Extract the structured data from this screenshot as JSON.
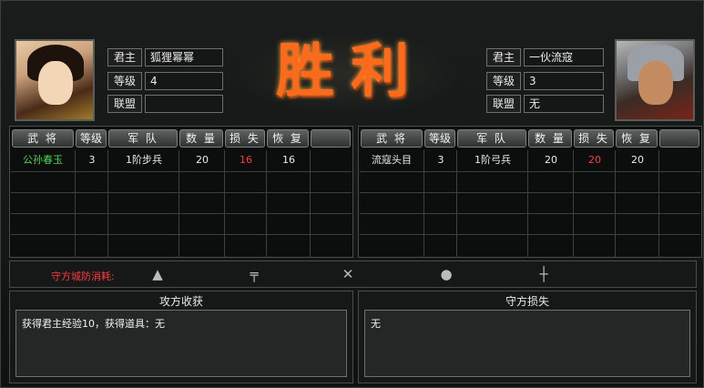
{
  "attacker": {
    "lord_label": "君主",
    "lord_name": "狐狸幂幂",
    "level_label": "等级",
    "level": "4",
    "alliance_label": "联盟",
    "alliance": ""
  },
  "defender": {
    "lord_label": "君主",
    "lord_name": "一伙流寇",
    "level_label": "等级",
    "level": "3",
    "alliance_label": "联盟",
    "alliance": "无"
  },
  "result_title": [
    "胜",
    "利"
  ],
  "table_headers": [
    "武 将",
    "等级",
    "军 队",
    "数 量",
    "损 失",
    "恢 复"
  ],
  "attacker_rows": [
    {
      "general": "公孙春玉",
      "level": "3",
      "army": "1阶步兵",
      "count": "20",
      "loss": "16",
      "recover": "16"
    }
  ],
  "defender_rows": [
    {
      "general": "流寇头目",
      "level": "3",
      "army": "1阶弓兵",
      "count": "20",
      "loss": "20",
      "recover": "20"
    }
  ],
  "defense": {
    "label": "守方城防消耗:",
    "icons": [
      "spikes-icon",
      "crossbow-trap-icon",
      "caltrop-icon",
      "stone-icon",
      "ballista-icon"
    ]
  },
  "attacker_gain": {
    "title": "攻方收获",
    "text": "获得君主经验10，获得道具：无"
  },
  "defender_loss": {
    "title": "守方损失",
    "text": "无"
  },
  "colors": {
    "victory": "#ff6a1a",
    "general_name": "#4fd34f",
    "loss": "#ff3b3b"
  }
}
